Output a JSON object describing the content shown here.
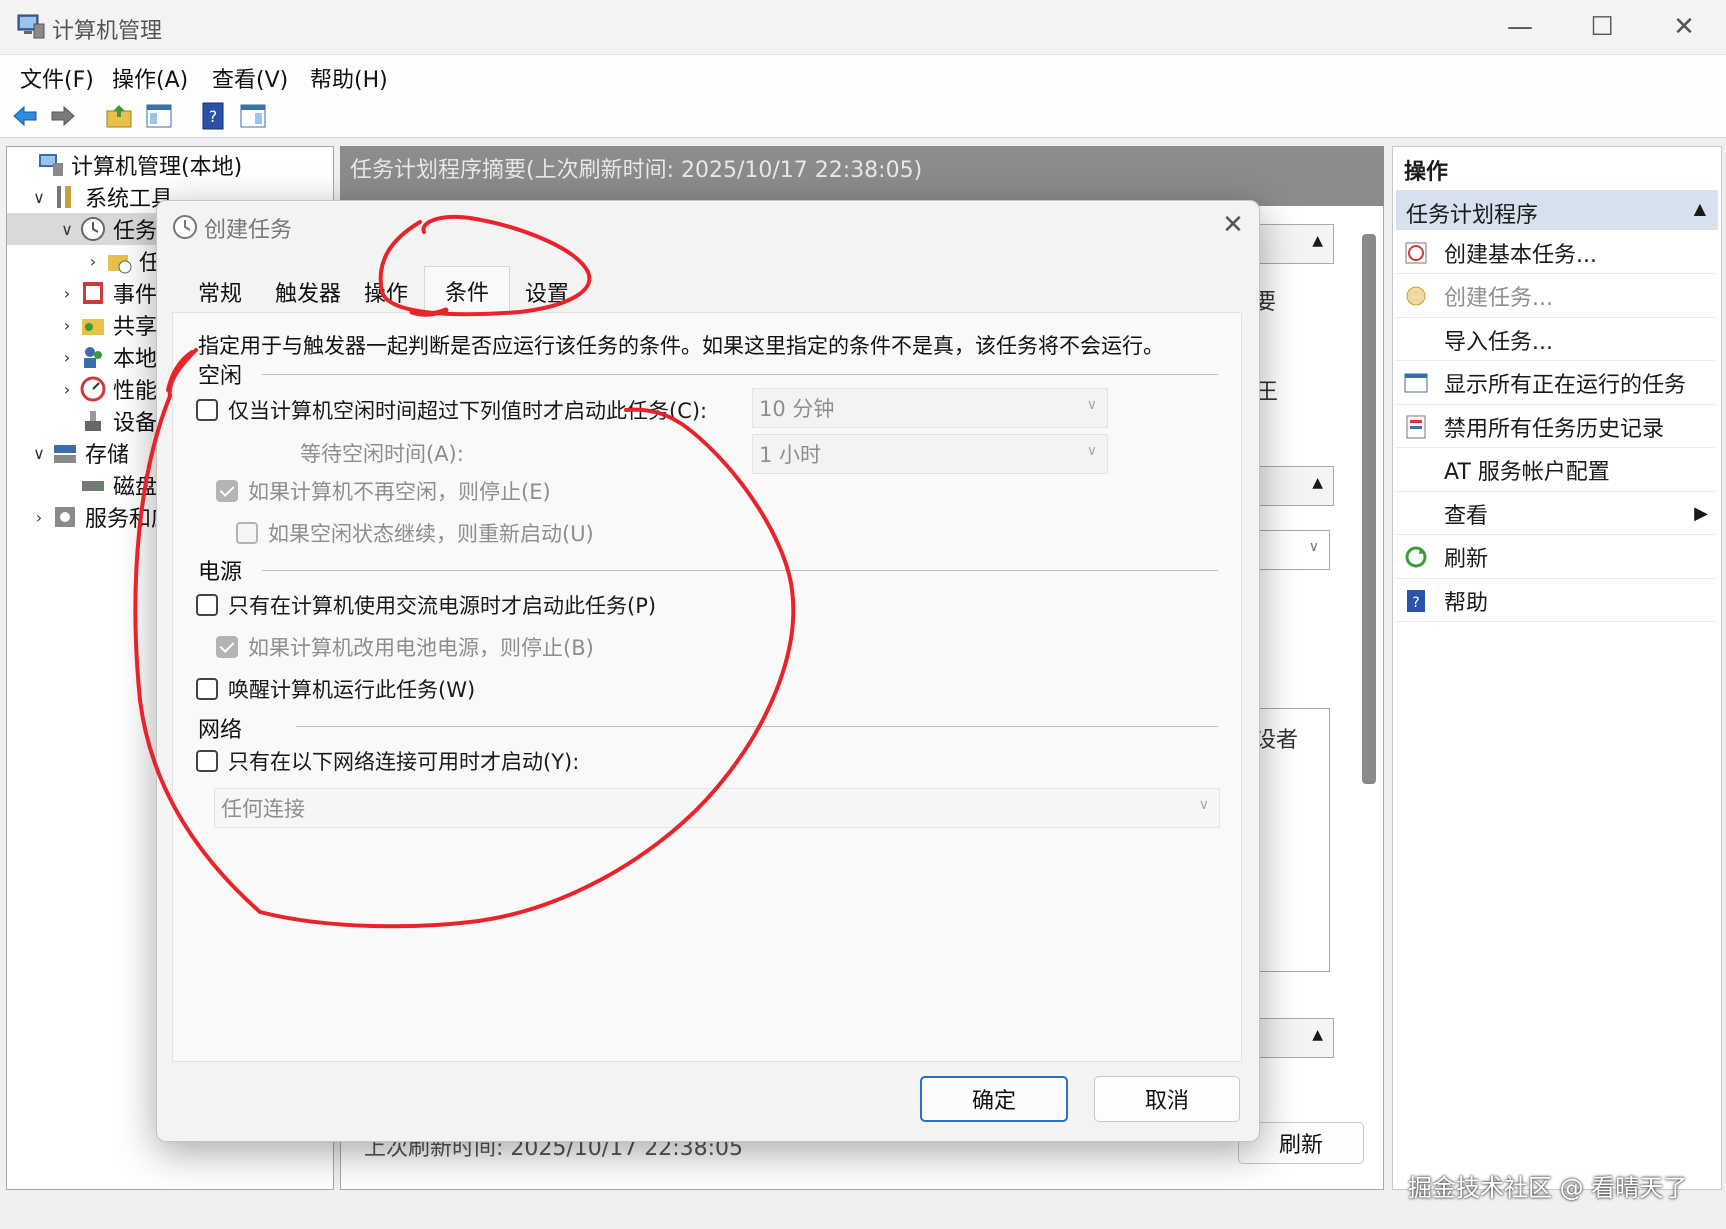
{
  "window": {
    "title": "计算机管理",
    "menu": [
      "文件(F)",
      "操作(A)",
      "查看(V)",
      "帮助(H)"
    ]
  },
  "tree": [
    {
      "label": "计算机管理(本地)",
      "icon": "computer-management-icon",
      "chev": ""
    },
    {
      "label": "系统工具",
      "icon": "system-tools-icon",
      "chev": "∨"
    },
    {
      "label": "任务",
      "icon": "task-scheduler-icon",
      "chev": "∨"
    },
    {
      "label": "任",
      "icon": "task-library-icon",
      "chev": "›"
    },
    {
      "label": "事件",
      "icon": "event-viewer-icon",
      "chev": "›"
    },
    {
      "label": "共享",
      "icon": "shared-folders-icon",
      "chev": "›"
    },
    {
      "label": "本地",
      "icon": "local-users-icon",
      "chev": "›"
    },
    {
      "label": "性能",
      "icon": "performance-icon",
      "chev": "›"
    },
    {
      "label": "设备",
      "icon": "device-manager-icon",
      "chev": ""
    },
    {
      "label": "存储",
      "icon": "storage-icon",
      "chev": "∨"
    },
    {
      "label": "磁盘",
      "icon": "disk-management-icon",
      "chev": ""
    },
    {
      "label": "服务和应",
      "icon": "services-icon",
      "chev": "›"
    }
  ],
  "center": {
    "header": "任务计划程序摘要(上次刷新时间: 2025/10/17 22:38:05)",
    "footer_status": "上次刷新时间: 2025/10/17 22:38:05",
    "refresh_button": "刷新",
    "peek_1": "要",
    "peek_2": "王",
    "peek_3": "设者"
  },
  "actions": {
    "header": "操作",
    "section": "任务计划程序",
    "items": [
      {
        "label": "创建基本任务...",
        "icon": "create-basic-task-icon",
        "disabled": false
      },
      {
        "label": "创建任务...",
        "icon": "create-task-icon",
        "disabled": true
      },
      {
        "label": "导入任务...",
        "icon": "",
        "disabled": false
      },
      {
        "label": "显示所有正在运行的任务",
        "icon": "running-tasks-icon",
        "disabled": false
      },
      {
        "label": "禁用所有任务历史记录",
        "icon": "task-history-icon",
        "disabled": false
      },
      {
        "label": "AT 服务帐户配置",
        "icon": "",
        "disabled": false
      },
      {
        "label": "查看",
        "icon": "",
        "disabled": false,
        "submenu": true
      },
      {
        "label": "刷新",
        "icon": "refresh-icon",
        "disabled": false
      },
      {
        "label": "帮助",
        "icon": "help-icon",
        "disabled": false
      }
    ]
  },
  "watermark": "掘金技术社区 @ 看晴天了",
  "dialog": {
    "title": "创建任务",
    "tabs": [
      "常规",
      "触发器",
      "操作",
      "条件",
      "设置"
    ],
    "active_tab": "条件",
    "description": "指定用于与触发器一起判断是否应运行该任务的条件。如果这里指定的条件不是真，该任务将不会运行。",
    "idle": {
      "label": "空闲",
      "start_only_if_idle": "仅当计算机空闲时间超过下列值时才启动此任务(C):",
      "idle_duration": "10 分钟",
      "wait_label": "等待空闲时间(A):",
      "wait_duration": "1 小时",
      "stop_if_not_idle": "如果计算机不再空闲，则停止(E)",
      "restart_if_idle": "如果空闲状态继续，则重新启动(U)"
    },
    "power": {
      "label": "电源",
      "ac_only": "只有在计算机使用交流电源时才启动此任务(P)",
      "stop_on_battery": "如果计算机改用电池电源，则停止(B)",
      "wake": "唤醒计算机运行此任务(W)"
    },
    "network": {
      "label": "网络",
      "only_if_network": "只有在以下网络连接可用时才启动(Y):",
      "connection": "任何连接"
    },
    "ok": "确定",
    "cancel": "取消"
  },
  "colors": {
    "accent": "#2a6fc9",
    "action_section_bg": "#d6e0ef",
    "annotation_red": "#e8232a"
  }
}
